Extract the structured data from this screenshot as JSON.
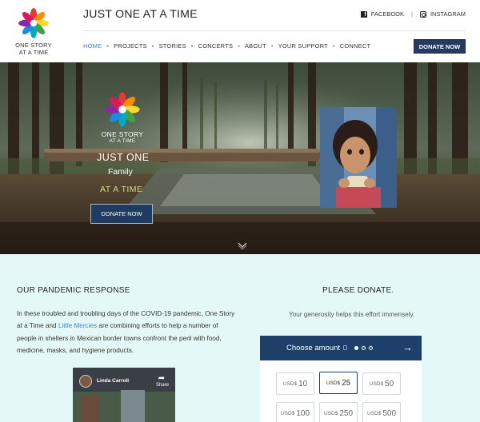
{
  "header": {
    "logo": {
      "line1": "ONE STORY",
      "line2": "AT A TIME"
    },
    "site_title": "JUST ONE AT A TIME",
    "social": {
      "facebook": "FACEBOOK",
      "separator": "|",
      "instagram": "INSTAGRAM"
    },
    "nav": {
      "items": [
        {
          "label": "HOME",
          "active": true
        },
        {
          "label": "PROJECTS"
        },
        {
          "label": "STORIES"
        },
        {
          "label": "CONCERTS"
        },
        {
          "label": "ABOUT"
        },
        {
          "label": "YOUR SUPPORT"
        },
        {
          "label": "CONNECT"
        }
      ],
      "separator": "•"
    },
    "donate_button": "DONATE NOW"
  },
  "hero": {
    "logo": {
      "line1": "ONE STORY",
      "line2": "AT A TIME"
    },
    "line1": "JUST ONE",
    "line2": "Family",
    "line3": "AT A TIME",
    "donate_button": "DONATE NOW"
  },
  "pandemic": {
    "title": "OUR PANDEMIC RESPONSE",
    "text_before_link": "In these troubled and troubling days of the COVID-19 pandemic, One Story at a Time and ",
    "link": "Little Mercies",
    "text_after_link": " are combining efforts to help a number of people in shelters in Mexican border towns confront the peril with food, medicine, masks, and hygiene products.",
    "video": {
      "channel": "Linda Carroll",
      "share": "Share"
    }
  },
  "donate": {
    "title": "PLEASE DONATE.",
    "subtitle": "Your generosity helps this effort immensely.",
    "widget": {
      "heading": "Choose amount",
      "currency": "USD$",
      "amounts": [
        {
          "value": "10"
        },
        {
          "value": "25",
          "selected": true
        },
        {
          "value": "50"
        },
        {
          "value": "100"
        },
        {
          "value": "250"
        },
        {
          "value": "500"
        }
      ]
    }
  },
  "colors": {
    "brand_navy": "#253a5e",
    "nav_active": "#4a7fb5",
    "section_bg": "#e4f9f7",
    "hero_accent": "#d8d88a"
  },
  "icons": [
    "logo-flower-icon",
    "facebook-icon",
    "instagram-icon",
    "chevron-down-icon",
    "share-icon",
    "lock-icon",
    "arrow-right-icon"
  ]
}
